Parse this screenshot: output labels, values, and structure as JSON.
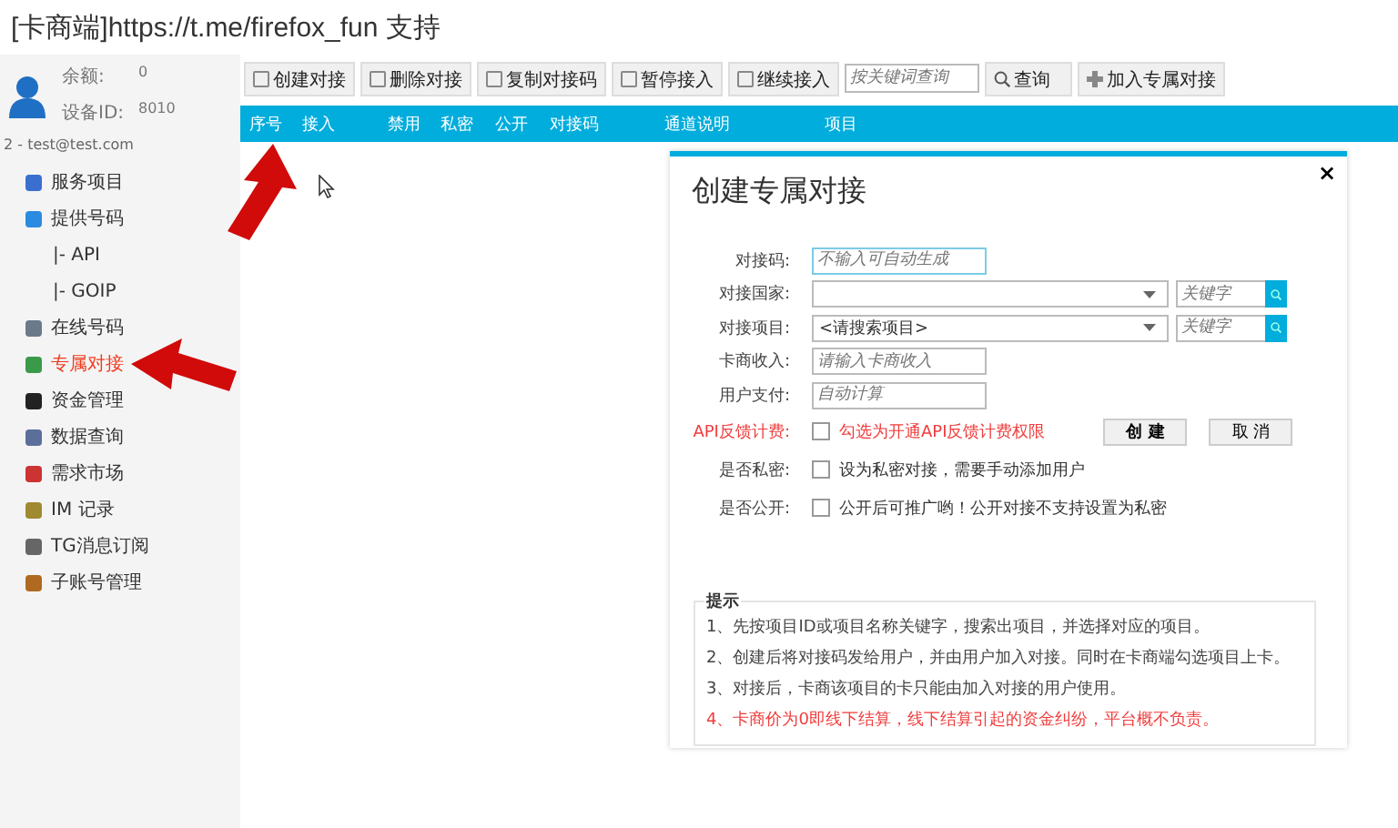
{
  "window": {
    "title": "[卡商端]https://t.me/firefox_fun 支持"
  },
  "account": {
    "balance_label": "余额:",
    "balance": "0",
    "device_label": "设备ID:",
    "device": "8010",
    "user": "2 - test@test.com"
  },
  "sidebar": {
    "items": [
      {
        "label": "服务项目",
        "selected": false
      },
      {
        "label": "提供号码",
        "selected": false,
        "children": [
          {
            "label": "|-  API",
            "selected": false
          },
          {
            "label": "|-  GOIP",
            "selected": false
          }
        ]
      },
      {
        "label": "在线号码",
        "selected": false
      },
      {
        "label": "专属对接",
        "selected": true
      },
      {
        "label": "资金管理",
        "selected": false
      },
      {
        "label": "数据查询",
        "selected": false
      },
      {
        "label": "需求市场",
        "selected": false
      },
      {
        "label": "IM 记录",
        "selected": false
      },
      {
        "label": "TG消息订阅",
        "selected": false
      },
      {
        "label": "子账号管理",
        "selected": false
      }
    ]
  },
  "toolbar": {
    "buttons": [
      "创建对接",
      "删除对接",
      "复制对接码",
      "暂停接入",
      "继续接入"
    ],
    "search": {
      "placeholder": "按关键词查询"
    },
    "query": "查询",
    "join": "加入专属对接"
  },
  "table": {
    "columns": [
      "序号",
      "接入",
      "禁用",
      "私密",
      "公开",
      "对接码",
      "通道说明",
      "项目"
    ]
  },
  "dialog": {
    "title": "创建专属对接",
    "close": "×",
    "rows": [
      {
        "kind": "text",
        "label": "对接码:",
        "placeholder": "不输入可自动生成",
        "focused": true,
        "highlight": false
      },
      {
        "kind": "select",
        "label": "对接国家:",
        "value": "",
        "keyword": {
          "placeholder": "关键字"
        },
        "highlight": false
      },
      {
        "kind": "select",
        "label": "对接项目:",
        "value": "<请搜索项目>",
        "keyword": {
          "placeholder": "关键字"
        },
        "highlight": false
      },
      {
        "kind": "text",
        "label": "卡商收入:",
        "placeholder": "请输入卡商收入",
        "focused": false,
        "highlight": false
      },
      {
        "kind": "text",
        "label": "用户支付:",
        "placeholder": "自动计算",
        "focused": false,
        "highlight": false
      },
      {
        "kind": "checkbox",
        "label": "API反馈计费:",
        "text": "勾选为开通API反馈计费权限",
        "checked": false,
        "highlight": true,
        "actions": [
          "创 建",
          "取 消"
        ]
      },
      {
        "kind": "checkbox",
        "label": "是否私密:",
        "text": "设为私密对接，需要手动添加用户",
        "checked": false,
        "highlight": false
      },
      {
        "kind": "checkbox",
        "label": "是否公开:",
        "text": "公开后可推广哟！公开对接不支持设置为私密",
        "checked": false,
        "highlight": false
      }
    ],
    "hints": {
      "title": "提示",
      "items": [
        {
          "kind": "note",
          "text": "1、先按项目ID或项目名称关键字，搜索出项目，并选择对应的项目。"
        },
        {
          "kind": "note",
          "text": "2、创建后将对接码发给用户，并由用户加入对接。同时在卡商端勾选项目上卡。"
        },
        {
          "kind": "note",
          "text": "3、对接后，卡商该项目的卡只能由加入对接的用户使用。"
        },
        {
          "kind": "warning",
          "text": "4、卡商价为0即线下结算，线下结算引起的资金纠纷，平台概不负责。"
        }
      ]
    }
  }
}
